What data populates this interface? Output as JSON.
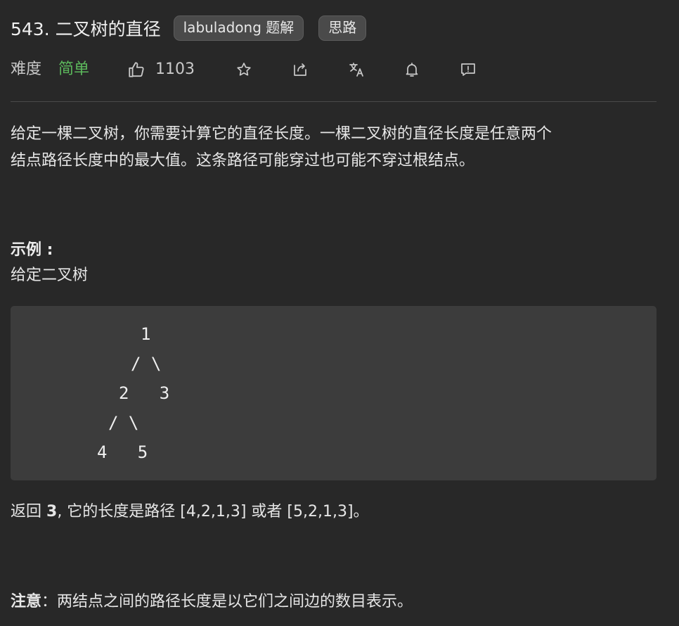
{
  "header": {
    "title": "543. 二叉树的直径",
    "pill_solution": "labuladong 题解",
    "pill_idea": "思路"
  },
  "meta": {
    "difficulty_label": "难度",
    "difficulty_value": "简单",
    "like_count": "1103",
    "icons": [
      "thumbs-up-icon",
      "star-icon",
      "share-icon",
      "translate-icon",
      "bell-icon",
      "feedback-icon"
    ]
  },
  "description": {
    "line1": "给定一棵二叉树，你需要计算它的直径长度。一棵二叉树的直径长度是任意两个",
    "line2": "结点路径长度中的最大值。这条路径可能穿过也可能不穿过根结点。"
  },
  "example": {
    "label": "示例 :",
    "intro": "给定二叉树",
    "code_lines": [
      "1",
      "/ \\",
      "2   3",
      "/ \\",
      "4   5"
    ]
  },
  "result": {
    "prefix": "返回 ",
    "bold": "3",
    "suffix": ", 它的长度是路径 [4,2,1,3] 或者 [5,2,1,3]。"
  },
  "note": {
    "bold": "注意",
    "text": "：两结点之间的路径长度是以它们之间边的数目表示。"
  },
  "colors": {
    "background": "#282828",
    "easy": "#5cb85c",
    "code_bg": "#3c3c3c"
  }
}
